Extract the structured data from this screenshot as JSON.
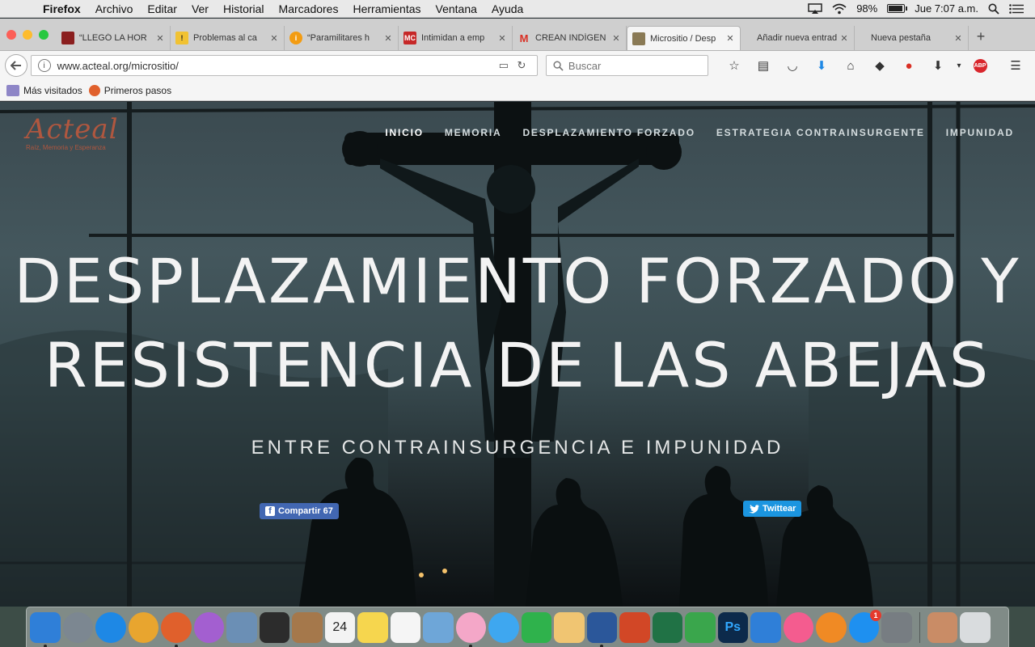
{
  "menubar": {
    "app_name": "Firefox",
    "items": [
      "Archivo",
      "Editar",
      "Ver",
      "Historial",
      "Marcadores",
      "Herramientas",
      "Ventana",
      "Ayuda"
    ],
    "battery_percent": "98%",
    "battery_level": 0.98,
    "clock": "Jue 7:07 a.m."
  },
  "tabs": [
    {
      "title": "“LLEGÓ LA HOR",
      "favicon": "dark-red-square",
      "color": "#8b1f1f",
      "active": false
    },
    {
      "title": "Problemas al ca",
      "favicon": "warning-icon",
      "color": "#f1c232",
      "active": false
    },
    {
      "title": "“Paramilitares h",
      "favicon": "info-orange-icon",
      "color": "#f39c12",
      "active": false
    },
    {
      "title": "Intimidan a emp",
      "favicon": "mc-logo",
      "color": "#c62828",
      "active": false
    },
    {
      "title": "CREAN INDÍGEN",
      "favicon": "gmail-icon",
      "color": "#d93025",
      "active": false
    },
    {
      "title": "Micrositio / Desp",
      "favicon": "bee-icon",
      "color": "#8a7a55",
      "active": true
    },
    {
      "title": "Añadir nueva entrad",
      "favicon": "",
      "color": "",
      "active": false
    },
    {
      "title": "Nueva pestaña",
      "favicon": "",
      "color": "",
      "active": false
    }
  ],
  "navbar": {
    "url": "www.acteal.org/micrositio/",
    "search_placeholder": "Buscar"
  },
  "bookmarks": [
    {
      "label": "Más visitados",
      "icon": "folder-icon"
    },
    {
      "label": "Primeros pasos",
      "icon": "firefox-icon"
    }
  ],
  "site": {
    "logo_word": "Acteal",
    "logo_tagline": "Raíz, Memoria y Esperanza",
    "nav": [
      "INICIO",
      "MEMORIA",
      "DESPLAZAMIENTO FORZADO",
      "ESTRATEGIA CONTRAINSURGENTE",
      "IMPUNIDAD"
    ],
    "hero_title_line1": "DESPLAZAMIENTO FORZADO Y",
    "hero_title_line2": "RESISTENCIA DE LAS ABEJAS",
    "hero_subtitle": "ENTRE CONTRAINSURGENCIA E IMPUNIDAD",
    "share_fb_label": "Compartir 67",
    "share_tw_label": "Twittear"
  },
  "dock": [
    {
      "name": "finder",
      "color": "#2f7fd8",
      "running": true
    },
    {
      "name": "launchpad",
      "color": "#7c8791",
      "running": false
    },
    {
      "name": "safari",
      "color": "#1e88e5",
      "running": false
    },
    {
      "name": "chrome",
      "color": "#e8a52f",
      "running": false
    },
    {
      "name": "firefox",
      "color": "#e0602c",
      "running": true
    },
    {
      "name": "picasa",
      "color": "#a35fd0",
      "running": false
    },
    {
      "name": "preview",
      "color": "#6b8fb5",
      "running": false
    },
    {
      "name": "imovie",
      "color": "#2c2c2c",
      "running": false
    },
    {
      "name": "contacts",
      "color": "#a5784b",
      "running": false
    },
    {
      "name": "calendar",
      "color": "#f3f3f3",
      "running": false,
      "label": "24"
    },
    {
      "name": "notes",
      "color": "#f6d64e",
      "running": false
    },
    {
      "name": "reminders",
      "color": "#f5f5f5",
      "running": false
    },
    {
      "name": "image-capture",
      "color": "#6ea6d8",
      "running": false
    },
    {
      "name": "photos",
      "color": "#f4a7c8",
      "running": true
    },
    {
      "name": "messages",
      "color": "#3ea7f0",
      "running": false
    },
    {
      "name": "facetime",
      "color": "#2fb24c",
      "running": false
    },
    {
      "name": "textedit",
      "color": "#f0c572",
      "running": false
    },
    {
      "name": "word",
      "color": "#2b579a",
      "running": true
    },
    {
      "name": "powerpoint",
      "color": "#d24726",
      "running": false
    },
    {
      "name": "excel",
      "color": "#207245",
      "running": false
    },
    {
      "name": "numbers",
      "color": "#3aa64c",
      "running": false
    },
    {
      "name": "photoshop",
      "color": "#0c2a4b",
      "running": false,
      "label": "Ps"
    },
    {
      "name": "keynote",
      "color": "#2f7fd8",
      "running": false
    },
    {
      "name": "itunes",
      "color": "#f45c8f",
      "running": false
    },
    {
      "name": "ibooks",
      "color": "#f08a24",
      "running": false
    },
    {
      "name": "app-store",
      "color": "#1e90f0",
      "running": false,
      "badge": "1"
    },
    {
      "name": "system-preferences",
      "color": "#777d82",
      "running": false
    },
    {
      "name": "downloads-stack",
      "color": "#c98c66",
      "running": false
    },
    {
      "name": "trash",
      "color": "#d9dcde",
      "running": false
    }
  ]
}
